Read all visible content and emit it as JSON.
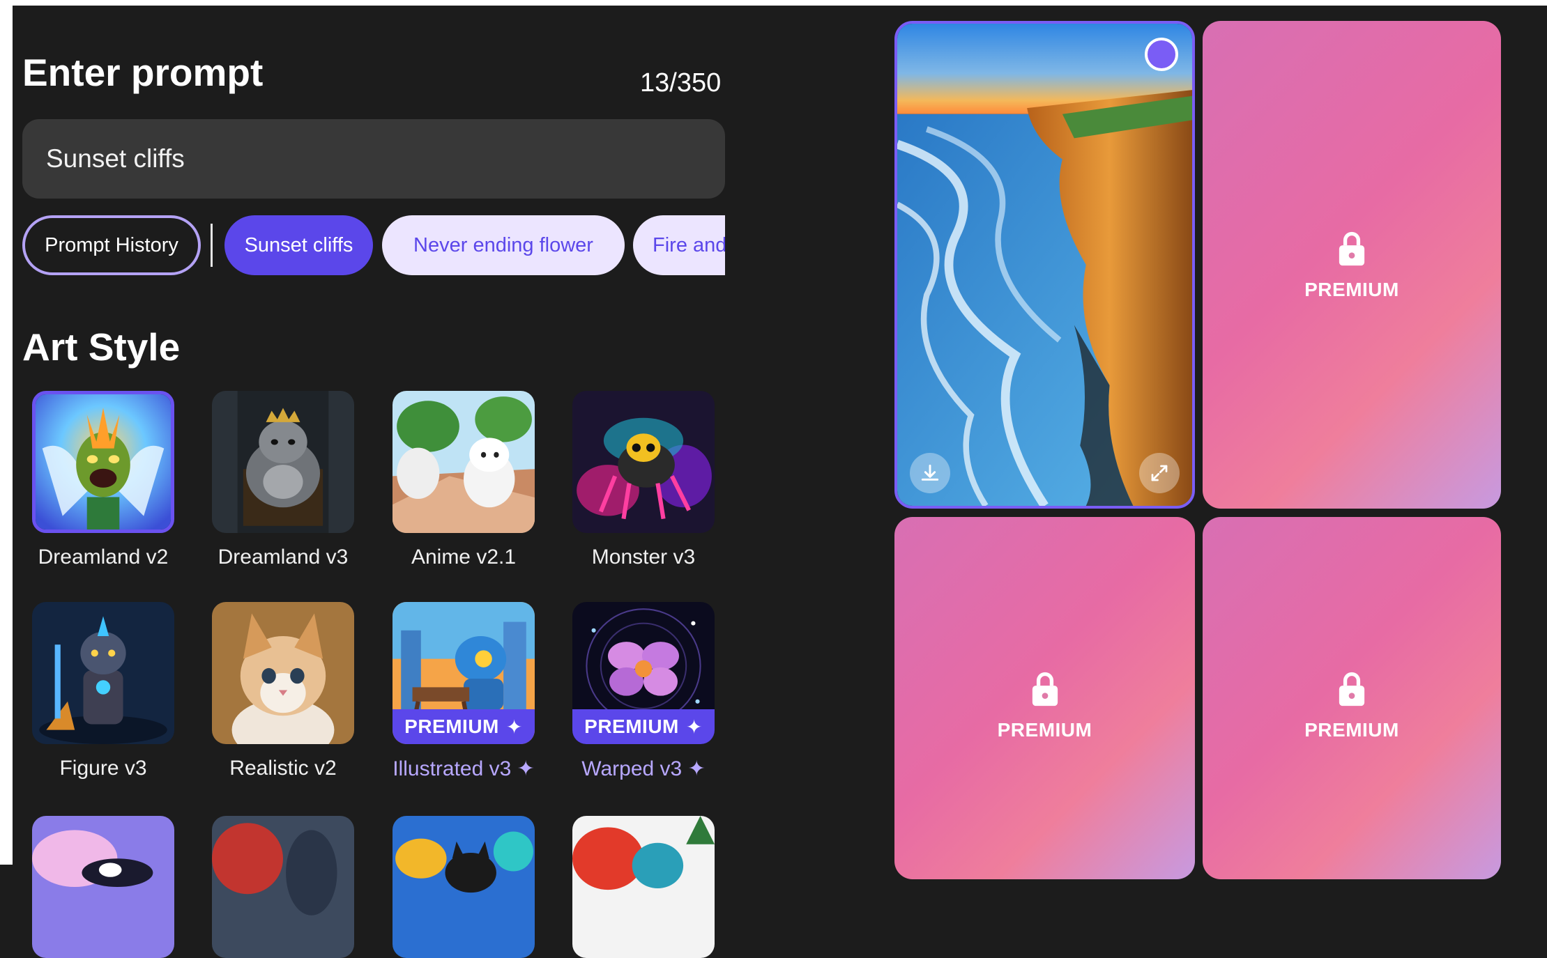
{
  "prompt": {
    "title": "Enter prompt",
    "counter": "13/350",
    "value": "Sunset cliffs"
  },
  "chips": [
    {
      "label": "Prompt History"
    },
    {
      "label": "Sunset cliffs"
    },
    {
      "label": "Never ending flower"
    },
    {
      "label": "Fire and w"
    }
  ],
  "art_style": {
    "title": "Art Style",
    "premium_badge": "PREMIUM",
    "premium_mark": "✦",
    "styles": [
      {
        "label": "Dreamland v2"
      },
      {
        "label": "Dreamland v3"
      },
      {
        "label": "Anime v2.1"
      },
      {
        "label": "Monster v3"
      },
      {
        "label": "Figure v3"
      },
      {
        "label": "Realistic v2"
      },
      {
        "label": "Illustrated v3 ✦"
      },
      {
        "label": "Warped v3 ✦"
      }
    ]
  },
  "results": {
    "locked_label": "PREMIUM"
  },
  "colors": {
    "accent": "#5b47ea",
    "background": "#1c1c1c",
    "chip_light": "#ece5ff"
  },
  "icons": {
    "lock": "lock-icon",
    "download": "download-icon",
    "expand": "expand-icon",
    "sparkle": "sparkle-icon"
  }
}
